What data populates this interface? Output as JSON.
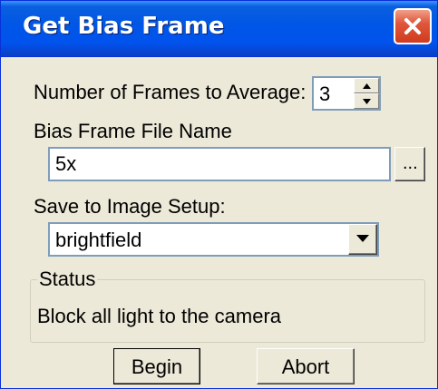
{
  "window": {
    "title": "Get Bias Frame"
  },
  "frames": {
    "label": "Number of Frames to Average:",
    "value": "3"
  },
  "bias_file": {
    "label": "Bias Frame File Name",
    "value": "5x",
    "browse_label": "..."
  },
  "image_setup": {
    "label": "Save to Image Setup:",
    "selected": "brightfield"
  },
  "status": {
    "legend": "Status",
    "text": "Block all light to the camera"
  },
  "buttons": {
    "begin": "Begin",
    "abort": "Abort"
  },
  "icons": {
    "close": "close-icon",
    "spin_up": "arrow-up-icon",
    "spin_down": "arrow-down-icon",
    "dropdown": "chevron-down-icon"
  },
  "colors": {
    "titlebar": "#0053ee",
    "window_bg": "#ece9d8",
    "close_button": "#e0583c",
    "field_border": "#7f9db9"
  }
}
